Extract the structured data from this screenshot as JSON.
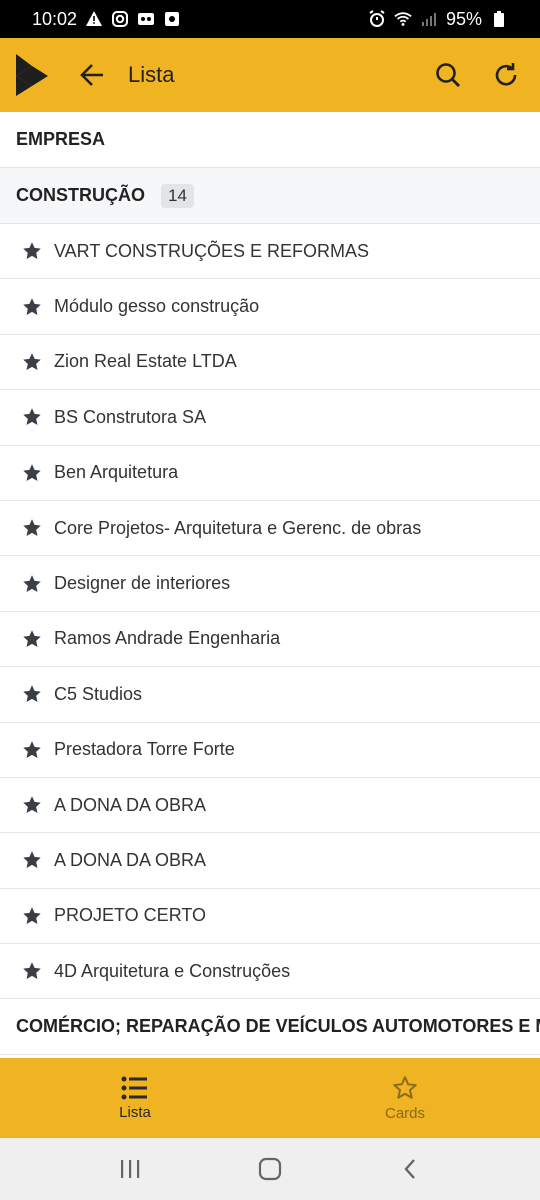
{
  "status_bar": {
    "time": "10:02",
    "battery": "95%",
    "left_icons": [
      "warning-icon",
      "instagram-icon",
      "voicemail-icon",
      "app-icon"
    ],
    "right_icons": [
      "alarm-icon",
      "wifi-icon",
      "signal-icon",
      "battery-icon"
    ]
  },
  "app_bar": {
    "title": "Lista",
    "background": "#F0B322"
  },
  "sections": {
    "empresa": {
      "title": "EMPRESA"
    },
    "construcao": {
      "title": "CONSTRUÇÃO",
      "count": "14",
      "items": [
        "VART CONSTRUÇÕES E REFORMAS",
        "Módulo gesso construção",
        "Zion Real Estate LTDA",
        "BS Construtora SA",
        "Ben Arquitetura",
        "Core Projetos- Arquitetura e Gerenc. de obras",
        "Designer de interiores",
        "Ramos Andrade Engenharia",
        "C5 Studios",
        "Prestadora Torre Forte",
        "A DONA DA OBRA",
        "A DONA DA OBRA",
        "PROJETO CERTO",
        "4D Arquitetura e Construções"
      ]
    },
    "comercio": {
      "title": "COMÉRCIO; REPARAÇÃO DE VEÍCULOS AUTOMOTORES E MOTOCICLETAS"
    }
  },
  "bottom_nav": {
    "tabs": [
      {
        "label": "Lista",
        "icon": "list-icon",
        "active": true
      },
      {
        "label": "Cards",
        "icon": "star-outline-icon",
        "active": false
      }
    ]
  }
}
